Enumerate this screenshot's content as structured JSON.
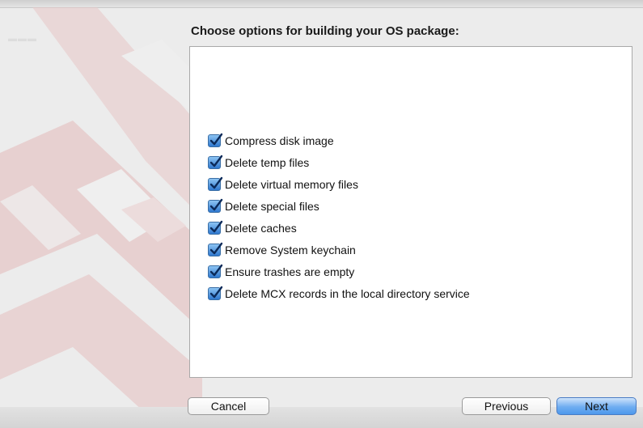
{
  "heading": "Choose options for building your OS package:",
  "options": [
    {
      "label": "Compress disk image",
      "checked": true
    },
    {
      "label": "Delete temp files",
      "checked": true
    },
    {
      "label": "Delete virtual memory files",
      "checked": true
    },
    {
      "label": "Delete special files",
      "checked": true
    },
    {
      "label": "Delete caches",
      "checked": true
    },
    {
      "label": "Remove System keychain",
      "checked": true
    },
    {
      "label": "Ensure trashes are empty",
      "checked": true
    },
    {
      "label": "Delete MCX records in the local directory service",
      "checked": true
    }
  ],
  "buttons": {
    "cancel": "Cancel",
    "previous": "Previous",
    "next": "Next"
  },
  "colors": {
    "window_bg": "#ececec",
    "accent": "#4d98ec",
    "art": "#d9a3a3"
  }
}
